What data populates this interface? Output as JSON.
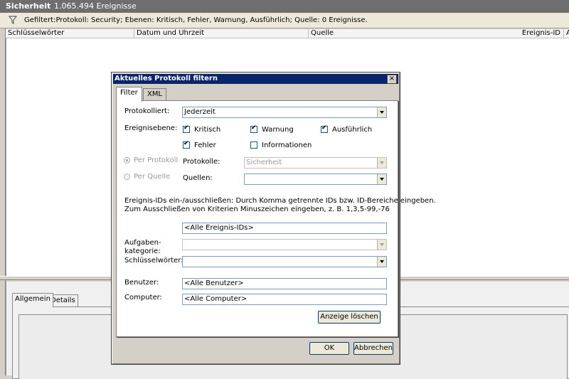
{
  "window": {
    "log_name": "Sicherheit",
    "event_count": "1.065.494 Ereignisse"
  },
  "filter_bar": {
    "text": "Gefiltert:Protokoll: Security; Ebenen: Kritisch, Fehler, Warnung, Ausführlich; Quelle:  0 Ereignisse.",
    "icon": "funnel-icon"
  },
  "columns": [
    "Schlüsselwörter",
    "Datum und Uhrzeit",
    "Quelle",
    "Ereignis-ID",
    "A"
  ],
  "lower_tabs": [
    "Allgemein",
    "Details"
  ],
  "dialog": {
    "title": "Aktuelles Protokoll filtern",
    "close": "×",
    "tabs": [
      "Filter",
      "XML"
    ],
    "logged_label": "Protokolliert:",
    "logged_value": "Jederzeit",
    "level_label": "Ereignisebene:",
    "levels": [
      {
        "label": "Kritisch",
        "checked": true
      },
      {
        "label": "Warnung",
        "checked": true
      },
      {
        "label": "Ausführlich",
        "checked": true
      },
      {
        "label": "Fehler",
        "checked": true
      },
      {
        "label": "Informationen",
        "checked": false
      }
    ],
    "per_log_label": "Per Protokoll",
    "per_source_label": "Per Quelle",
    "logs_label": "Protokolle:",
    "logs_value": "Sicherheit",
    "sources_label": "Quellen:",
    "sources_value": "",
    "event_ids_help_line1": "Ereignis-IDs ein-/ausschließen: Durch Komma getrennte IDs bzw. ID-Bereiche eingeben.",
    "event_ids_help_line2": "Zum Ausschließen von Kriterien Minuszeichen eingeben, z. B. 1,3,5-99,-76",
    "event_ids_value": "<Alle Ereignis-IDs>",
    "task_category_label_line1": "Aufgaben-",
    "task_category_label_line2": "kategorie:",
    "task_category_value": "",
    "keywords_label": "Schlüsselwörter:",
    "keywords_value": "",
    "user_label": "Benutzer:",
    "user_value": "<Alle Benutzer>",
    "computer_label": "Computer:",
    "computer_value": "<Alle Computer>",
    "clear_button": "Anzeige löschen",
    "ok_button": "OK",
    "cancel_button": "Abbrechen"
  }
}
